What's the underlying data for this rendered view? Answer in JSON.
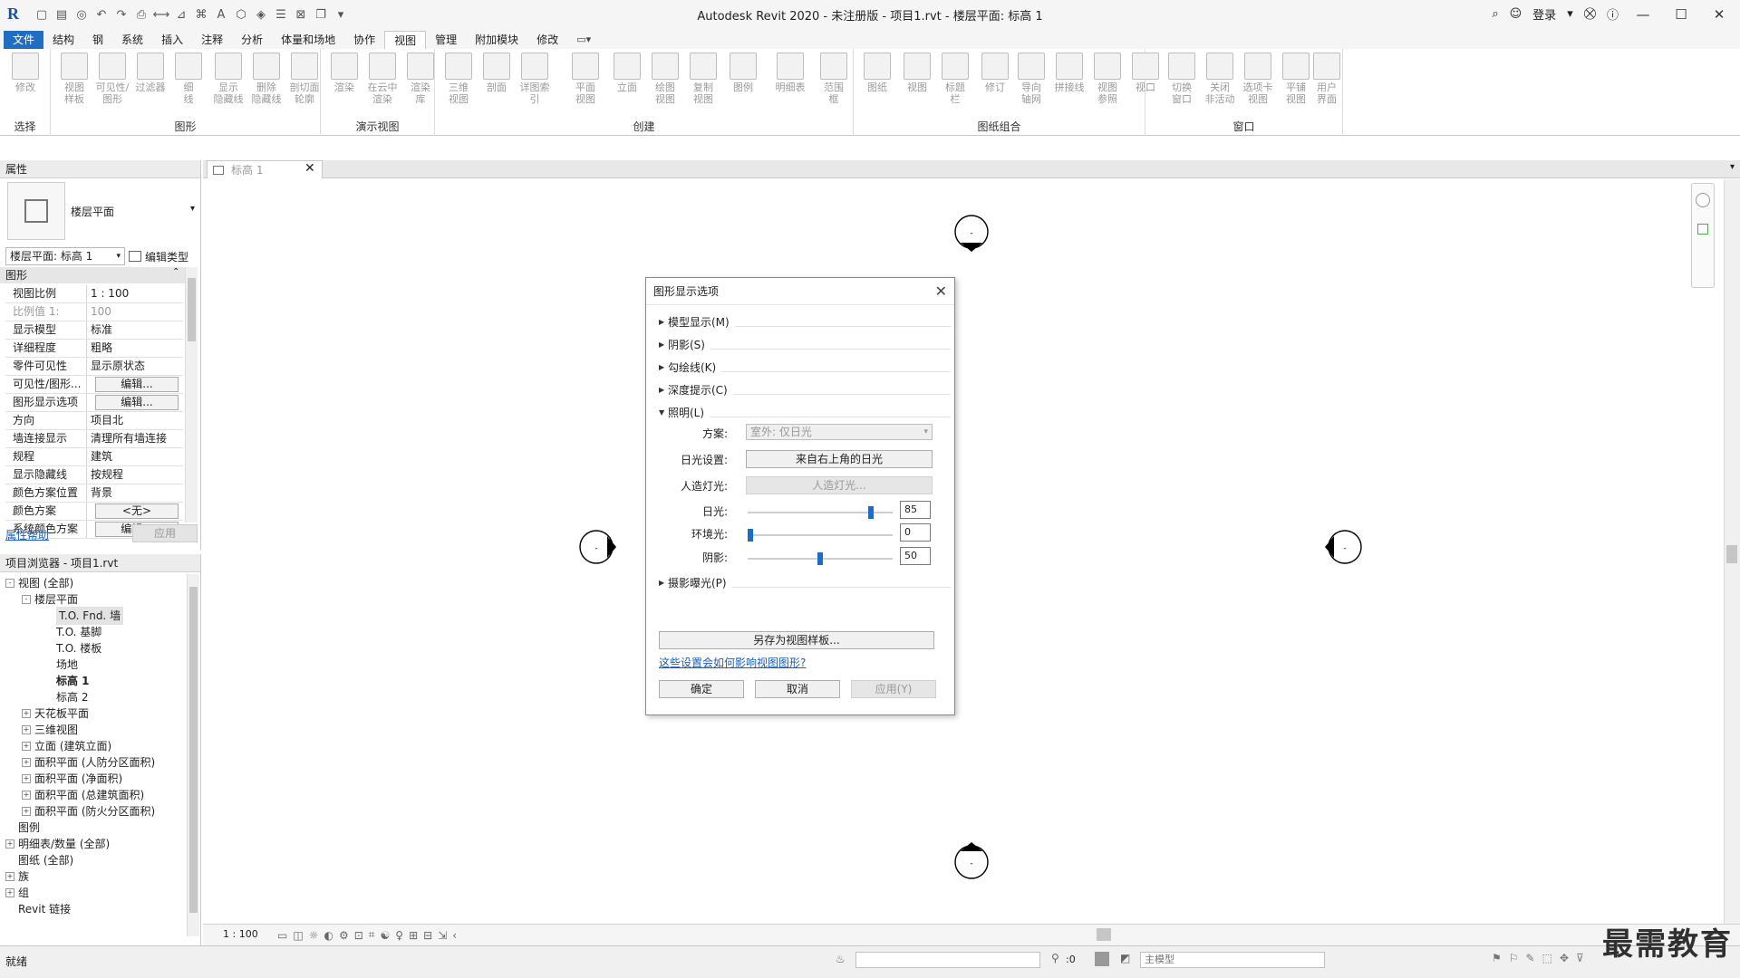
{
  "window": {
    "title": "Autodesk Revit 2020 - 未注册版 - 项目1.rvt - 楼层平面: 标高 1",
    "signin": "登录"
  },
  "tabs": [
    "文件",
    "结构",
    "钢",
    "系统",
    "插入",
    "注释",
    "分析",
    "体量和场地",
    "协作",
    "视图",
    "管理",
    "附加模块",
    "修改"
  ],
  "ribbon": {
    "select_label": "选择",
    "groups": [
      "图形",
      "演示视图",
      "创建",
      "图纸组合",
      "窗口"
    ],
    "buttons": [
      {
        "label": "修改"
      },
      {
        "label": "视图\n样板"
      },
      {
        "label": "可见性/\n图形"
      },
      {
        "label": "过滤器"
      },
      {
        "label": "细\n线"
      },
      {
        "label": "显示\n隐藏线"
      },
      {
        "label": "删除\n隐藏线"
      },
      {
        "label": "剖切面\n轮廓"
      },
      {
        "label": "渲染"
      },
      {
        "label": "在云中\n渲染"
      },
      {
        "label": "渲染\n库"
      },
      {
        "label": "三维\n视图"
      },
      {
        "label": "剖面"
      },
      {
        "label": "详图索引"
      },
      {
        "label": "平面\n视图"
      },
      {
        "label": "立面"
      },
      {
        "label": "绘图\n视图"
      },
      {
        "label": "复制\n视图"
      },
      {
        "label": "图例"
      },
      {
        "label": "明细表"
      },
      {
        "label": "范围\n框"
      },
      {
        "label": "图纸"
      },
      {
        "label": "视图"
      },
      {
        "label": "标题\n栏"
      },
      {
        "label": "修订"
      },
      {
        "label": "导向\n轴网"
      },
      {
        "label": "拼接线"
      },
      {
        "label": "视图\n参照"
      },
      {
        "label": "视口"
      },
      {
        "label": "切换\n窗口"
      },
      {
        "label": "关闭\n非活动"
      },
      {
        "label": "选项卡\n视图"
      },
      {
        "label": "平铺\n视图"
      },
      {
        "label": "用户\n界面"
      }
    ]
  },
  "properties": {
    "header": "属性",
    "type_name": "楼层平面",
    "instance_selector": "楼层平面: 标高 1",
    "edit_type": "编辑类型",
    "section": "图形",
    "rows": [
      {
        "name": "视图比例",
        "value": "1 : 100"
      },
      {
        "name": "比例值 1:",
        "value": "100"
      },
      {
        "name": "显示模型",
        "value": "标准"
      },
      {
        "name": "详细程度",
        "value": "粗略"
      },
      {
        "name": "零件可见性",
        "value": "显示原状态"
      },
      {
        "name": "可见性/图形...",
        "value": "编辑..."
      },
      {
        "name": "图形显示选项",
        "value": "编辑..."
      },
      {
        "name": "方向",
        "value": "项目北"
      },
      {
        "name": "墙连接显示",
        "value": "清理所有墙连接"
      },
      {
        "name": "规程",
        "value": "建筑"
      },
      {
        "name": "显示隐藏线",
        "value": "按规程"
      },
      {
        "name": "颜色方案位置",
        "value": "背景"
      },
      {
        "name": "颜色方案",
        "value": "<无>"
      },
      {
        "name": "系统颜色方案",
        "value": "编辑..."
      }
    ],
    "help_link": "属性帮助",
    "apply": "应用"
  },
  "browser": {
    "header": "项目浏览器 - 项目1.rvt",
    "items": [
      {
        "label": "视图 (全部)",
        "level": 0,
        "exp": "-"
      },
      {
        "label": "楼层平面",
        "level": 1,
        "exp": "-"
      },
      {
        "label": "T.O. Fnd. 墙",
        "level": 2
      },
      {
        "label": "T.O. 基脚",
        "level": 2
      },
      {
        "label": "T.O. 楼板",
        "level": 2
      },
      {
        "label": "场地",
        "level": 2
      },
      {
        "label": "标高 1",
        "level": 2
      },
      {
        "label": "标高 2",
        "level": 2
      },
      {
        "label": "天花板平面",
        "level": 1,
        "exp": "+"
      },
      {
        "label": "三维视图",
        "level": 1,
        "exp": "+"
      },
      {
        "label": "立面 (建筑立面)",
        "level": 1,
        "exp": "+"
      },
      {
        "label": "面积平面 (人防分区面积)",
        "level": 1,
        "exp": "+"
      },
      {
        "label": "面积平面 (净面积)",
        "level": 1,
        "exp": "+"
      },
      {
        "label": "面积平面 (总建筑面积)",
        "level": 1,
        "exp": "+"
      },
      {
        "label": "面积平面 (防火分区面积)",
        "level": 1,
        "exp": "+"
      },
      {
        "label": "图例",
        "level": 0
      },
      {
        "label": "明细表/数量 (全部)",
        "level": 0,
        "exp": "+"
      },
      {
        "label": "图纸 (全部)",
        "level": 0
      },
      {
        "label": "族",
        "level": 0,
        "exp": "+"
      },
      {
        "label": "组",
        "level": 0,
        "exp": "+"
      },
      {
        "label": "Revit 链接",
        "level": 0
      }
    ]
  },
  "view_tab": "标高 1",
  "dialog": {
    "title": "图形显示选项",
    "sections": [
      "模型显示(M)",
      "阴影(S)",
      "勾绘线(K)",
      "深度提示(C)",
      "照明(L)",
      "摄影曝光(P)"
    ],
    "scheme_label": "方案:",
    "scheme_value": "室外: 仅日光",
    "sun_setting_label": "日光设置:",
    "sun_setting_value": "来自右上角的日光",
    "artificial_label": "人造灯光:",
    "artificial_value": "人造灯光...",
    "sun_label": "日光:",
    "sun_value": "85",
    "ambient_label": "环境光:",
    "ambient_value": "0",
    "shadow_label": "阴影:",
    "shadow_value": "50",
    "save_template": "另存为视图样板...",
    "help_link": "这些设置会如何影响视图图形?",
    "ok": "确定",
    "cancel": "取消",
    "apply": "应用(Y)"
  },
  "viewbar": {
    "scale": "1 : 100"
  },
  "status": {
    "text": "就绪",
    "zero": ":0",
    "model": "主模型"
  },
  "watermark": "最需教育"
}
